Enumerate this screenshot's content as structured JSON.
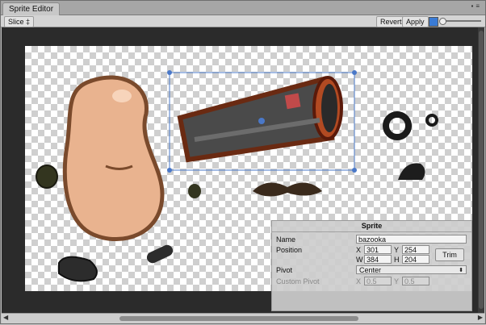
{
  "window": {
    "tab_title": "Sprite Editor"
  },
  "toolbar": {
    "slice_label": "Slice ‡",
    "revert_label": "Revert",
    "apply_label": "Apply"
  },
  "selection": {
    "pivot": "center"
  },
  "panel": {
    "title": "Sprite",
    "name_label": "Name",
    "name_value": "bazooka",
    "position_label": "Position",
    "x_label": "X",
    "x_value": "301",
    "y_label": "Y",
    "y_value": "254",
    "w_label": "W",
    "w_value": "384",
    "h_label": "H",
    "h_value": "204",
    "trim_label": "Trim",
    "pivot_label": "Pivot",
    "pivot_value": "Center",
    "custom_pivot_label": "Custom Pivot",
    "cx_label": "X",
    "cx_value": "0.5",
    "cy_label": "Y",
    "cy_value": "0.5"
  }
}
